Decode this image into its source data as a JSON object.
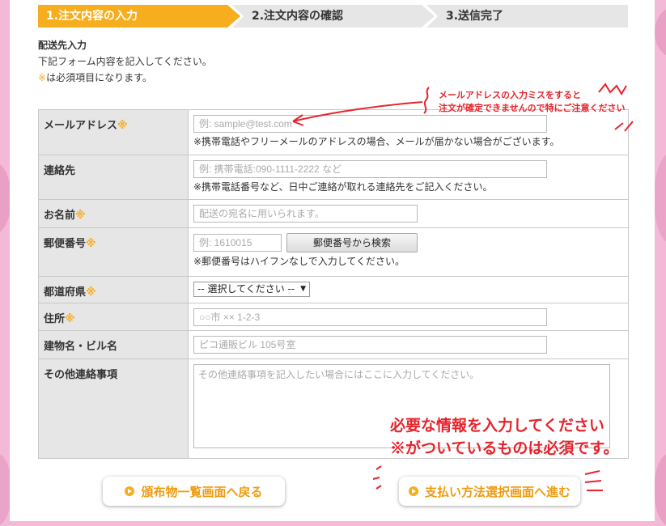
{
  "steps": [
    {
      "label": "1.注文内容の入力",
      "active": true
    },
    {
      "label": "2.注文内容の確認",
      "active": false
    },
    {
      "label": "3.送信完了",
      "active": false
    }
  ],
  "intro": {
    "heading": "配送先入力",
    "line1": "下記フォーム内容を記入してください。",
    "req_mark": "※",
    "line2": "は必須項目になります。"
  },
  "req_mark": "※",
  "fields": {
    "email": {
      "label": "メールアドレス",
      "placeholder": "例: sample@test.com",
      "note": "※携帯電話やフリーメールのアドレスの場合、メールが届かない場合がございます。"
    },
    "contact": {
      "label": "連絡先",
      "placeholder": "例: 携帯電話:090-1111-2222 など",
      "note": "※携帯電話番号など、日中ご連絡が取れる連絡先をご記入ください。"
    },
    "name": {
      "label": "お名前",
      "placeholder": "配送の宛名に用いられます。"
    },
    "postal": {
      "label": "郵便番号",
      "placeholder": "例: 1610015",
      "search_button": "郵便番号から検索",
      "note": "※郵便番号はハイフンなしで入力してください。"
    },
    "prefecture": {
      "label": "都道府県",
      "selected": "-- 選択してください --"
    },
    "address": {
      "label": "住所",
      "placeholder": "○○市 ×× 1-2-3"
    },
    "building": {
      "label": "建物名・ビル名",
      "placeholder": "ピコ通販ビル 105号室"
    },
    "other": {
      "label": "その他連絡事項",
      "placeholder": "その他連絡事項を記入したい場合にはここに入力してください。"
    }
  },
  "annotations": {
    "email_line1": "メールアドレスの入力ミスをすると",
    "email_line2": "注文が確定できませんので特にご注意ください",
    "bottom_line1": "必要な情報を入力してください",
    "bottom_line2": "※がついているものは必須です。"
  },
  "buttons": {
    "back": "頒布物一覧画面へ戻る",
    "next": "支払い方法選択画面へ進む"
  },
  "colors": {
    "accent": "#f6ad1e",
    "annotation": "#e8232c",
    "background": "#f4b9d6"
  }
}
